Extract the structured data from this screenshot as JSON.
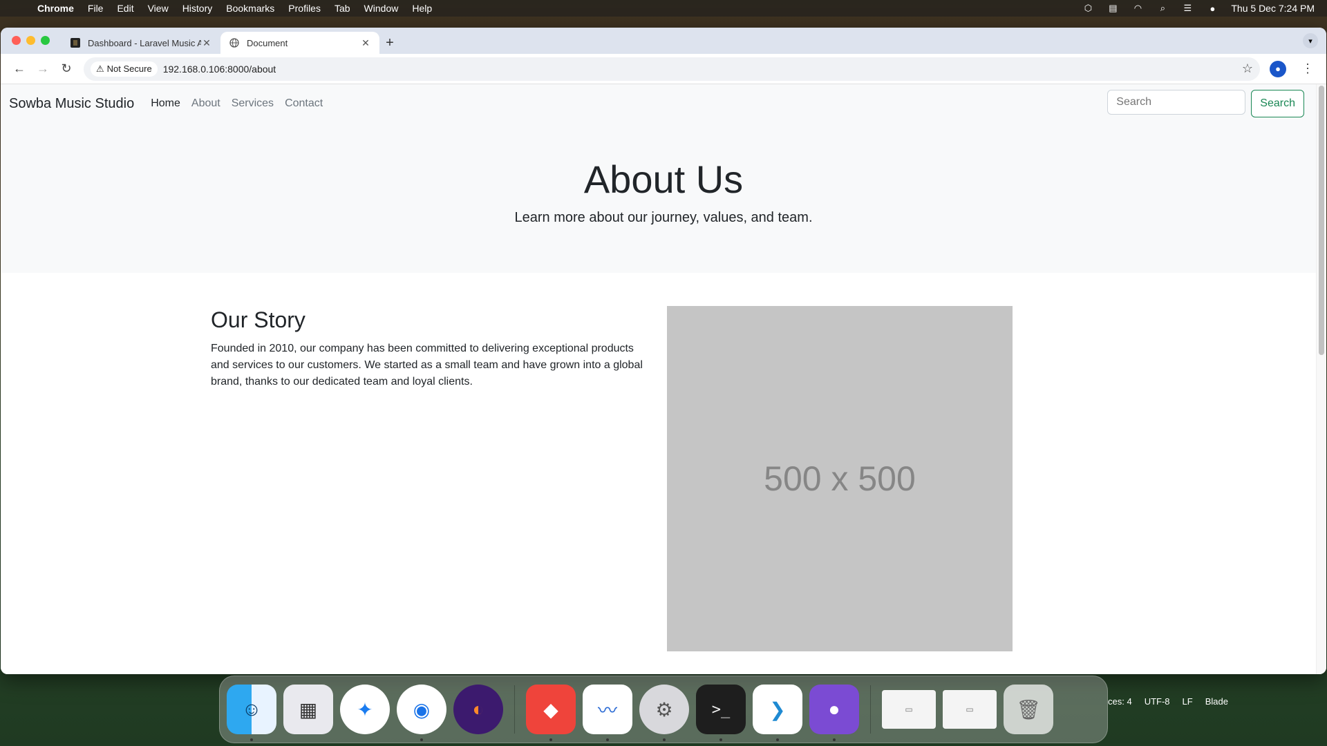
{
  "menubar": {
    "app": "Chrome",
    "items": [
      "File",
      "Edit",
      "View",
      "History",
      "Bookmarks",
      "Profiles",
      "Tab",
      "Window",
      "Help"
    ],
    "clock": "Thu 5 Dec  7:24 PM",
    "status_icons": [
      "box-icon",
      "drive-icon",
      "wifi-icon",
      "spotlight-icon",
      "control-center-icon",
      "siri-icon"
    ]
  },
  "browser": {
    "tabs": [
      {
        "title": "Dashboard - Laravel Music Ap",
        "active": false
      },
      {
        "title": "Document",
        "active": true
      }
    ],
    "security_label": "Not Secure",
    "url": "192.168.0.106:8000/about"
  },
  "site": {
    "brand": "Sowba Music Studio",
    "nav": [
      "Home",
      "About",
      "Services",
      "Contact"
    ],
    "search_placeholder": "Search",
    "search_button": "Search",
    "hero": {
      "title": "About Us",
      "subtitle": "Learn more about our journey, values, and team."
    },
    "story": {
      "heading": "Our Story",
      "body": "Founded in 2010, our company has been committed to delivering exceptional products and services to our customers. We started as a small team and have grown into a global brand, thanks to our dedicated team and loyal clients.",
      "image_label": "500 x 500"
    }
  },
  "dock": {
    "apps": [
      "Finder",
      "Launchpad",
      "Safari",
      "Chrome",
      "Firefox",
      "AnyDesk",
      "Freeform",
      "System Settings",
      "Terminal",
      "Visual Studio Code",
      "GitHub Desktop"
    ],
    "statusbar_peek": [
      "ces: 4",
      "UTF-8",
      "LF",
      "Blade"
    ]
  }
}
